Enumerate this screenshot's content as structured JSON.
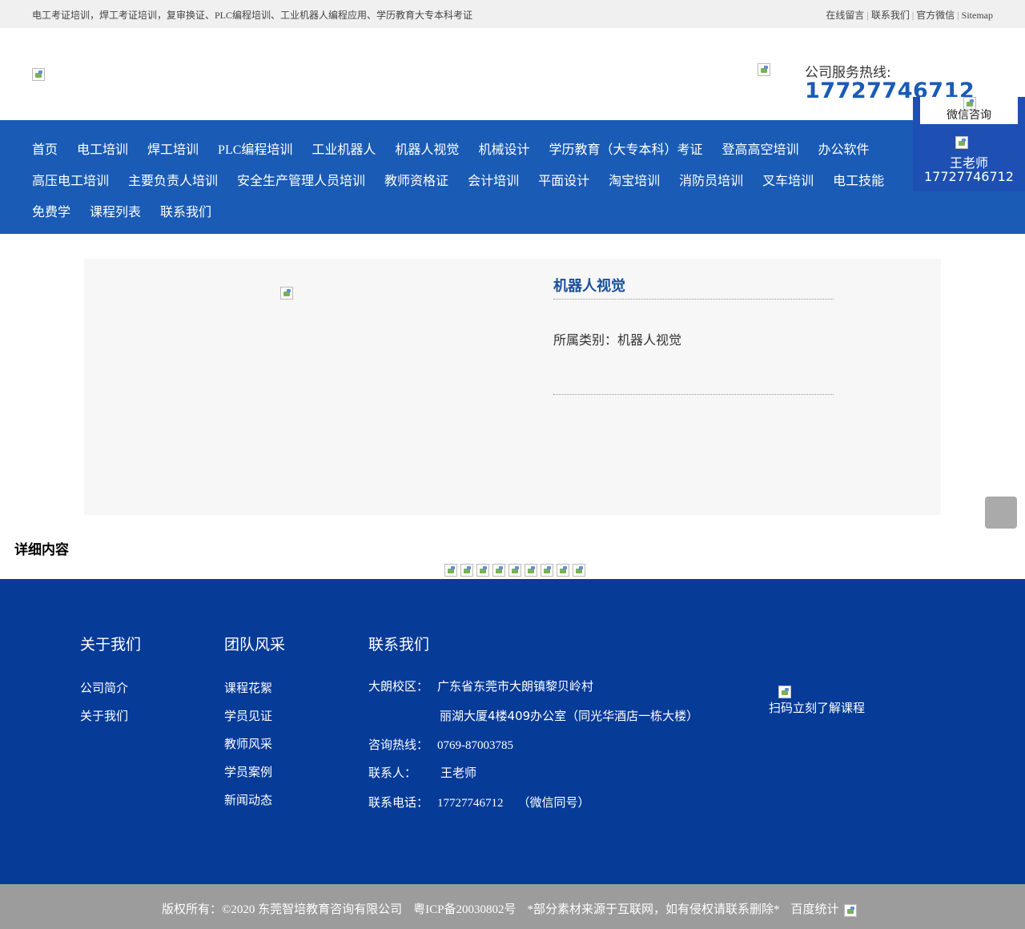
{
  "topbar": {
    "tagline": "电工考证培训，焊工考证培训，复审换证、PLC编程培训、工业机器人编程应用、学历教育大专本科考证",
    "links": [
      "在线留言",
      "联系我们",
      "官方微信",
      "Sitemap"
    ]
  },
  "header": {
    "hotline_label": "公司服务热线:",
    "hotline_number": "17727746712"
  },
  "nav": {
    "row1": [
      "首页",
      "电工培训",
      "焊工培训",
      "PLC编程培训",
      "工业机器人",
      "机器人视觉",
      "机械设计",
      "学历教育（大专本科）考证",
      "登高高空培训",
      "办公软件"
    ],
    "row2": [
      "高压电工培训",
      "主要负责人培训",
      "安全生产管理人员培训",
      "教师资格证",
      "会计培训",
      "平面设计",
      "淘宝培训",
      "消防员培训",
      "叉车培训",
      "电工技能"
    ],
    "row3": [
      "免费学",
      "课程列表",
      "联系我们"
    ]
  },
  "float": {
    "wechat_label": "微信咨询",
    "name": "王老师",
    "phone": "17727746712"
  },
  "product": {
    "title": "机器人视觉",
    "category": "所属类别：机器人视觉"
  },
  "detail": {
    "title": "详细内容",
    "image_count": 9
  },
  "footer": {
    "about": {
      "heading": "关于我们",
      "items": [
        "公司简介",
        "关于我们"
      ]
    },
    "team": {
      "heading": "团队风采",
      "items": [
        "课程花絮",
        "学员见证",
        "教师风采",
        "学员案例",
        "新闻动态"
      ]
    },
    "contact": {
      "heading": "联系我们",
      "campus_label": "大朗校区：",
      "address1": "广东省东莞市大朗镇黎贝岭村",
      "address2": "丽湖大厦4楼409办公室（同光华酒店一栋大楼）",
      "hotline_label": "咨询热线：",
      "hotline": "0769-87003785",
      "person_label": "联系人：",
      "person": "王老师",
      "phone_label": "联系电话：",
      "phone": "17727746712",
      "phone_note": "（微信同号）"
    },
    "qr_caption": "扫码立刻了解课程"
  },
  "copyright": {
    "owner": "版权所有：©2020  东莞智培教育咨询有限公司",
    "icp": "粤ICP备20030802号",
    "notice": "*部分素材来源于互联网，如有侵权请联系删除*",
    "stats": "百度统计"
  }
}
